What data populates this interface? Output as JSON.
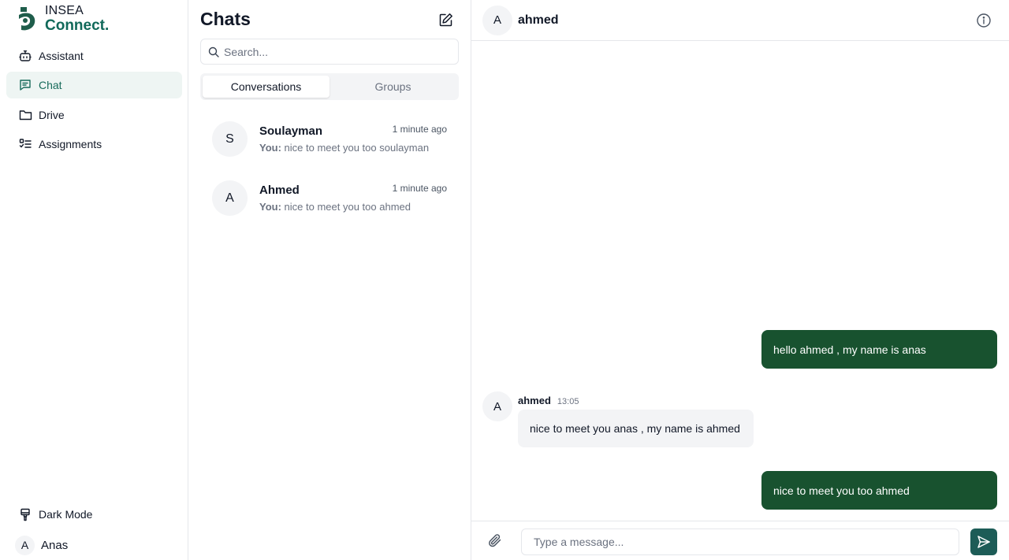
{
  "app": {
    "logo_line1": "INSEA",
    "logo_line2": "Connect.",
    "brand_color": "#11695a"
  },
  "sidebar": {
    "items": [
      {
        "label": "Assistant",
        "icon": "robot-icon",
        "active": false
      },
      {
        "label": "Chat",
        "icon": "message-square-icon",
        "active": true
      },
      {
        "label": "Drive",
        "icon": "folder-icon",
        "active": false
      },
      {
        "label": "Assignments",
        "icon": "list-todo-icon",
        "active": false
      }
    ],
    "dark_mode_label": "Dark Mode",
    "user": {
      "initial": "A",
      "name": "Anas"
    }
  },
  "chat_list": {
    "title": "Chats",
    "search_placeholder": "Search...",
    "tabs": [
      {
        "label": "Conversations",
        "active": true
      },
      {
        "label": "Groups",
        "active": false
      }
    ],
    "conversations": [
      {
        "initial": "S",
        "name": "Soulayman",
        "time": "1 minute ago",
        "prefix": "You:",
        "preview": "nice to meet you too soulayman"
      },
      {
        "initial": "A",
        "name": "Ahmed",
        "time": "1 minute ago",
        "prefix": "You:",
        "preview": "nice to meet you too ahmed"
      }
    ]
  },
  "conversation": {
    "contact_initial": "A",
    "contact_name": "ahmed",
    "messages": [
      {
        "direction": "out",
        "text": "hello ahmed , my name is anas"
      },
      {
        "direction": "in",
        "sender": "ahmed",
        "initial": "A",
        "time": "13:05",
        "text": "nice to meet you anas , my name is ahmed"
      },
      {
        "direction": "out",
        "text": "nice to meet you too ahmed"
      }
    ],
    "input_placeholder": "Type a message...",
    "outgoing_color": "#18522f",
    "send_color": "#1d5c57"
  }
}
